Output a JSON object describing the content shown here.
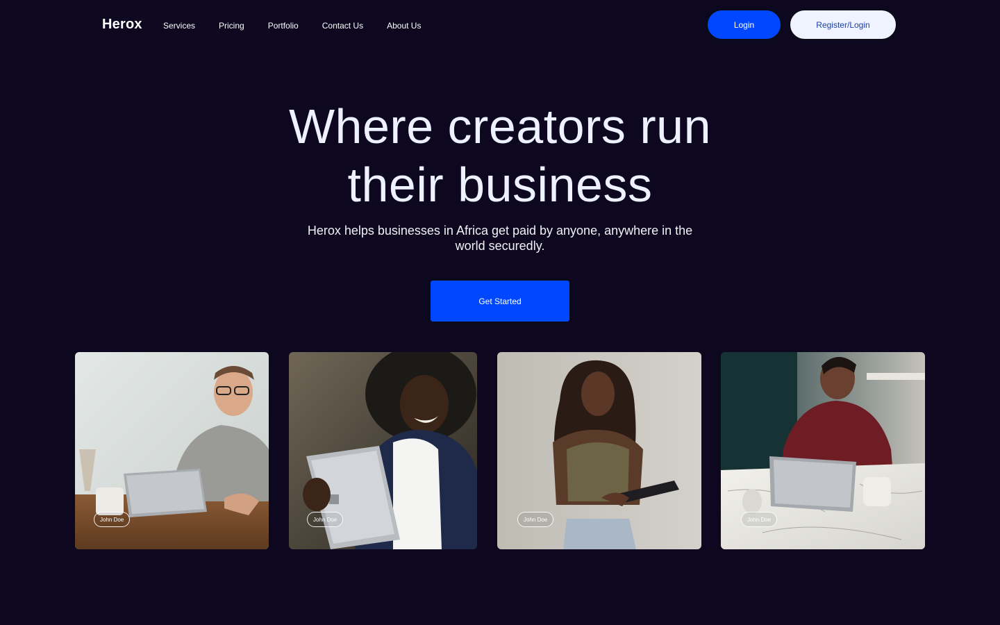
{
  "nav": {
    "logo": "Herox",
    "links": [
      "Services",
      "Pricing",
      "Portfolio",
      "Contact Us",
      "About Us"
    ],
    "login_label": "Login",
    "register_label": "Register/Login"
  },
  "hero": {
    "title_line1": "Where creators run",
    "title_line2": "their business",
    "subtitle": "Herox helps businesses in Africa get paid by anyone, anywhere in the world securedly.",
    "cta_label": "Get Started"
  },
  "cards": [
    {
      "name": "John Doe",
      "image": "man-with-glasses-laptop-photo"
    },
    {
      "name": "John Doe",
      "image": "smiling-man-tablet-photo"
    },
    {
      "name": "John Doe",
      "image": "woman-using-tablet-photo"
    },
    {
      "name": "John Doe",
      "image": "person-laptop-marble-table-photo"
    }
  ],
  "colors": {
    "background": "#0d0820",
    "primary": "#0048ff",
    "light_button": "#eef3ff"
  }
}
